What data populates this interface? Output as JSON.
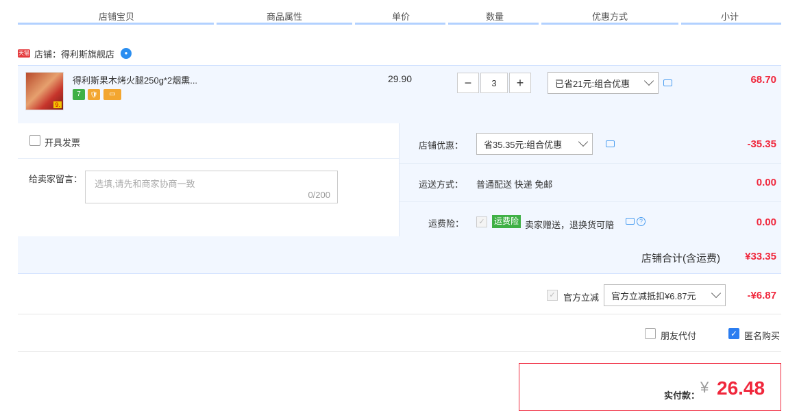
{
  "header": {
    "cols": [
      "店铺宝贝",
      "商品属性",
      "单价",
      "数量",
      "优惠方式",
      "小计"
    ]
  },
  "shop": {
    "badge": "天猫",
    "name": "店铺：得利斯旗舰店"
  },
  "item": {
    "title": "得利斯果木烤火腿250g*2烟熏...",
    "thumb_tag": "9.",
    "badges": [
      "7",
      "🛡",
      "▭"
    ],
    "price": "29.90",
    "qty_minus": "−",
    "qty": "3",
    "qty_plus": "+",
    "promo": "已省21元:组合优惠",
    "subtotal": "68.70"
  },
  "invoice": {
    "label": "开具发票"
  },
  "message": {
    "label": "给卖家留言：",
    "placeholder": "选填,请先和商家协商一致",
    "counter": "0/200"
  },
  "store_discount": {
    "label": "店铺优惠：",
    "value": "省35.35元:组合优惠",
    "amount": "-35.35"
  },
  "shipping": {
    "label": "运送方式：",
    "value": "普通配送 快递 免邮",
    "amount": "0.00"
  },
  "insurance": {
    "label": "运费险：",
    "tag": "运费险",
    "desc": "卖家赠送，退换货可赔",
    "amount": "0.00"
  },
  "store_total": {
    "label": "店铺合计(含运费)",
    "amount": "¥33.35"
  },
  "official": {
    "label": "官方立减",
    "value": "官方立减抵扣¥6.87元",
    "amount": "-¥6.87"
  },
  "options": {
    "friend_pay": "朋友代付",
    "anonymous": "匿名购买"
  },
  "payment": {
    "label": "实付款：",
    "currency": "¥",
    "amount": "26.48"
  },
  "colors": {
    "accent_red": "#f0273c",
    "accent_blue": "#2b7df0",
    "panel_bg": "#f2f7ff"
  }
}
